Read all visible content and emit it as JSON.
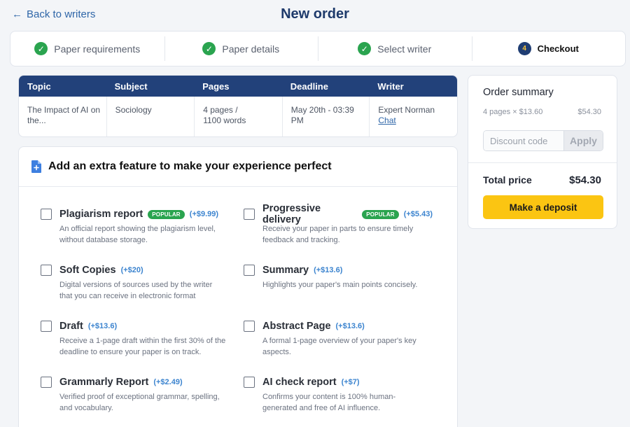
{
  "header": {
    "back_label": "Back to writers",
    "title": "New order"
  },
  "steps": [
    {
      "label": "Paper requirements",
      "status": "done"
    },
    {
      "label": "Paper details",
      "status": "done"
    },
    {
      "label": "Select writer",
      "status": "done"
    },
    {
      "label": "Checkout",
      "status": "active",
      "number": "4"
    }
  ],
  "order_table": {
    "columns": [
      "Topic",
      "Subject",
      "Pages",
      "Deadline",
      "Writer"
    ],
    "row": {
      "topic_line1": "The Impact of AI on",
      "topic_line2": "the...",
      "subject": "Sociology",
      "pages_line1": "4 pages /",
      "pages_line2": "1100 words",
      "deadline_line1": "May 20th - 03:39",
      "deadline_line2": "PM",
      "writer": "Expert Norman",
      "chat_label": "Chat"
    }
  },
  "features": {
    "title": "Add an extra feature to make your experience perfect",
    "items": [
      {
        "name": "Plagiarism report",
        "badge": "POPULAR",
        "price": "(+$9.99)",
        "desc1": "An official report showing the plagiarism level,",
        "desc2": "without database storage."
      },
      {
        "name": "Progressive delivery",
        "badge": "POPULAR",
        "price": "(+$5.43)",
        "desc1": "Receive your paper in parts to ensure timely",
        "desc2": "feedback and tracking."
      },
      {
        "name": "Soft Copies",
        "price": "(+$20)",
        "desc1": "Digital versions of sources used by the writer",
        "desc2": "that you can receive in electronic format"
      },
      {
        "name": "Summary",
        "price": "(+$13.6)",
        "desc1": "Highlights your paper's main points concisely.",
        "desc2": ""
      },
      {
        "name": "Draft",
        "price": "(+$13.6)",
        "desc1": "Receive a 1-page draft within the first 30% of the",
        "desc2": "deadline to ensure your paper is on track."
      },
      {
        "name": "Abstract Page",
        "price": "(+$13.6)",
        "desc1": "A formal 1-page overview of your paper's key",
        "desc2": "aspects."
      },
      {
        "name": "Grammarly Report",
        "price": "(+$2.49)",
        "desc1": "Verified proof of exceptional grammar, spelling,",
        "desc2": "and vocabulary."
      },
      {
        "name": "AI check report",
        "price": "(+$7)",
        "desc1": "Confirms your content is 100% human-",
        "desc2": "generated and free of AI influence."
      }
    ]
  },
  "summary": {
    "title": "Order summary",
    "line_label": "4 pages × $13.60",
    "line_amount": "$54.30",
    "discount_placeholder": "Discount code",
    "apply_label": "Apply",
    "total_label": "Total price",
    "total_amount": "$54.30",
    "deposit_label": "Make a deposit"
  },
  "colors": {
    "accent_navy": "#22417a",
    "success_green": "#2aa44f",
    "cta_yellow": "#fbc512",
    "link_blue": "#2f66a8",
    "price_blue": "#3c84cf"
  }
}
